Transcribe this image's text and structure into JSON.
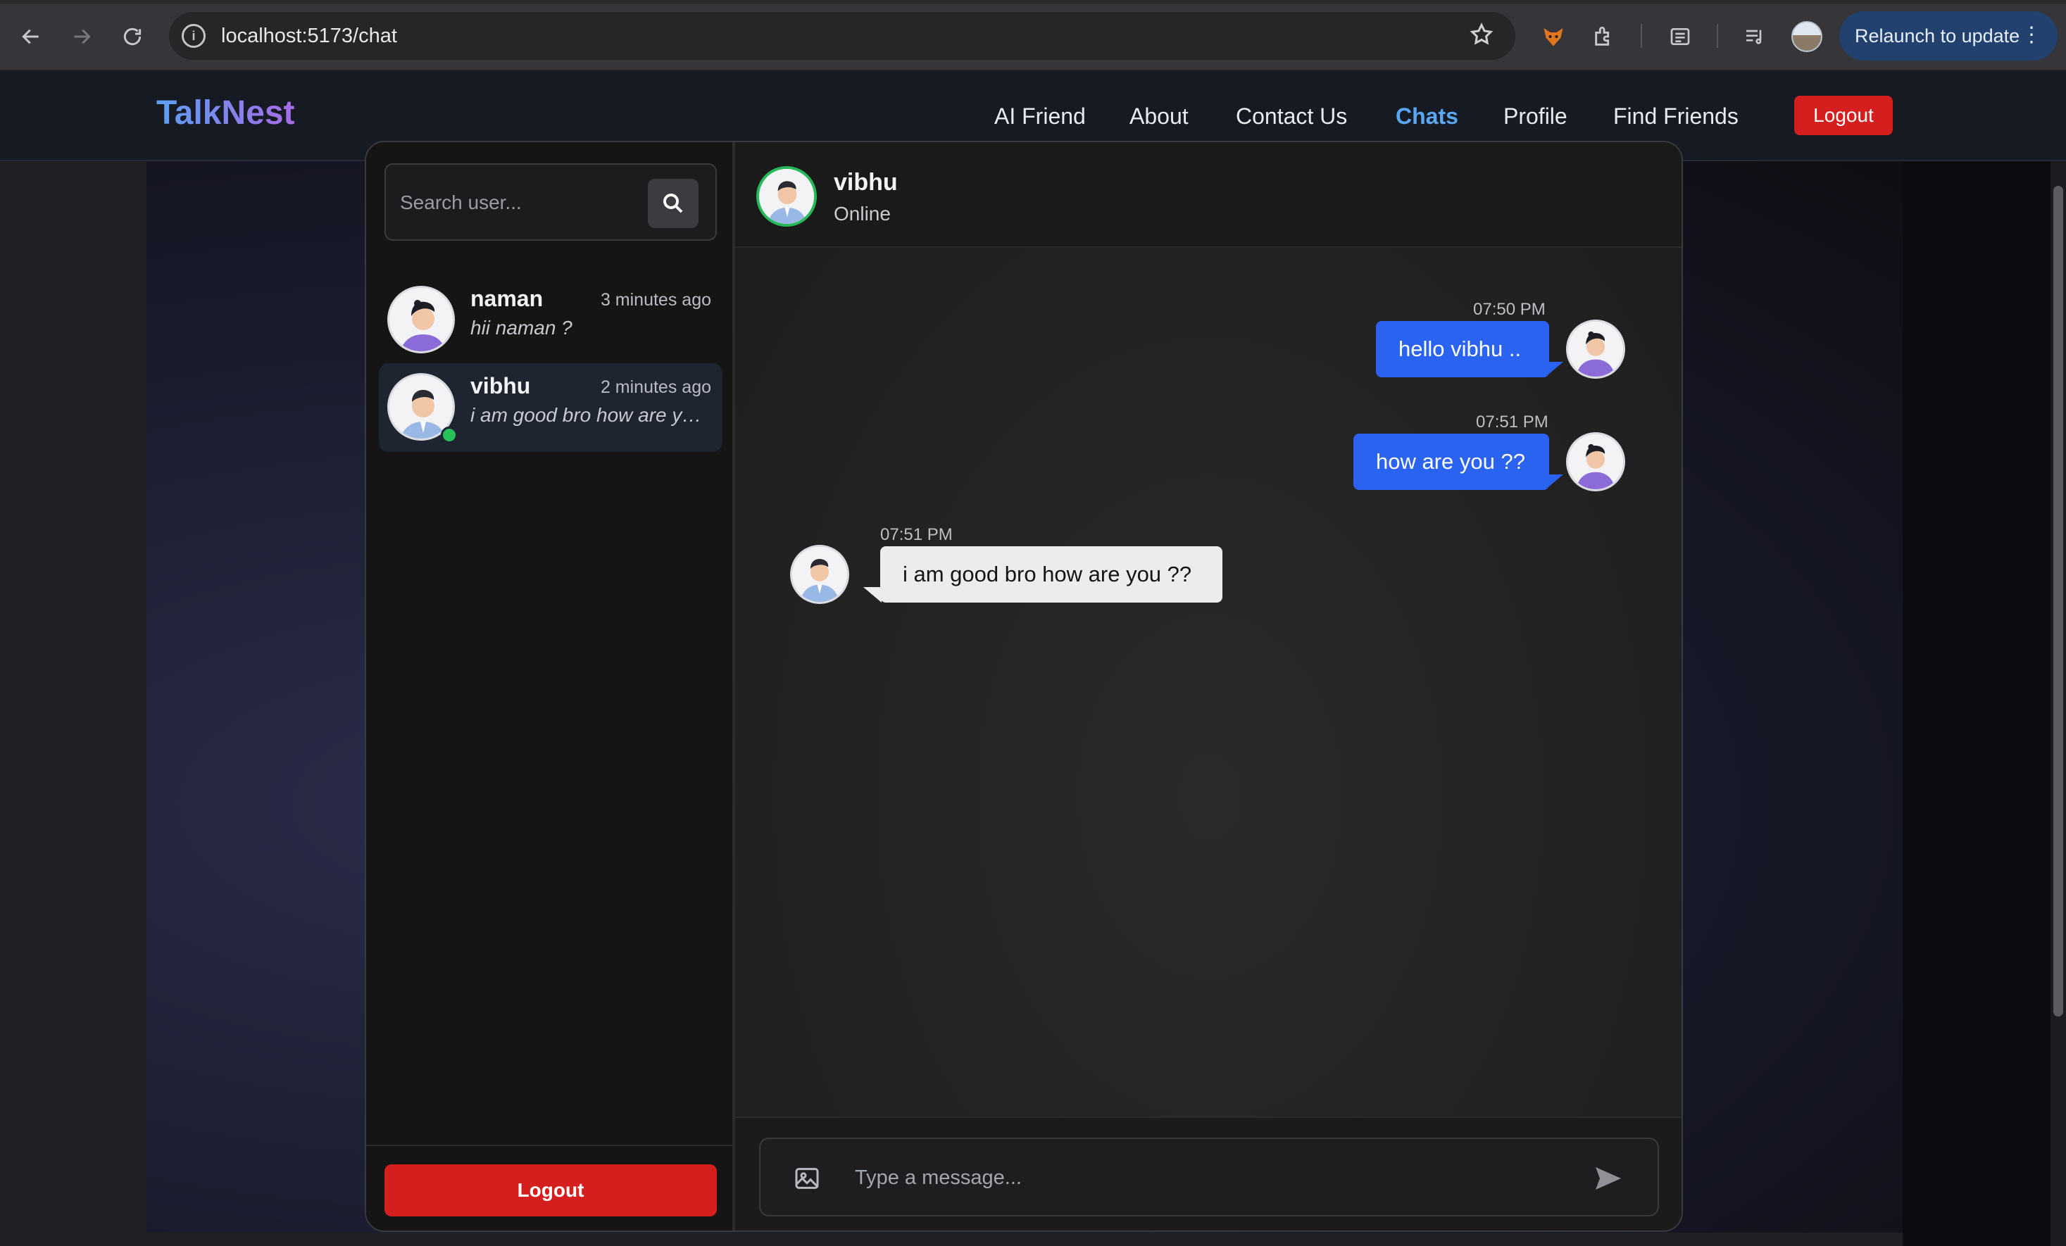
{
  "browser": {
    "url": "localhost:5173/chat",
    "relaunch_label": "Relaunch to update"
  },
  "nav": {
    "logo": "TalkNest",
    "links": [
      "AI Friend",
      "About",
      "Contact Us",
      "Chats",
      "Profile",
      "Find Friends"
    ],
    "active_link": "Chats",
    "logout": "Logout"
  },
  "sidebar": {
    "search_placeholder": "Search user...",
    "contacts": [
      {
        "name": "naman",
        "time": "3 minutes ago",
        "preview": "hii naman ?",
        "online": false,
        "active": false
      },
      {
        "name": "vibhu",
        "time": "2 minutes ago",
        "preview": "i am good bro how are you ??",
        "online": true,
        "active": true
      }
    ],
    "logout": "Logout"
  },
  "chat": {
    "name": "vibhu",
    "status": "Online",
    "messages": [
      {
        "time": "07:50 PM",
        "text": "hello vibhu ..",
        "direction": "out"
      },
      {
        "time": "07:51 PM",
        "text": "how are you ??",
        "direction": "out"
      },
      {
        "time": "07:51 PM",
        "text": "i am good bro how are you ??",
        "direction": "in"
      }
    ],
    "input_placeholder": "Type a message..."
  },
  "colors": {
    "accent_blue": "#2a63f0",
    "logout_red": "#d51f1f",
    "active_link": "#5aa7f5",
    "online_green": "#27c15a"
  }
}
